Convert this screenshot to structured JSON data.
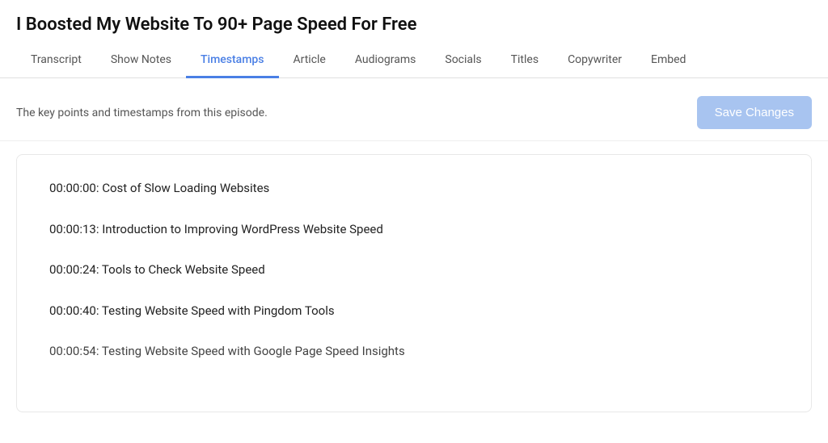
{
  "page": {
    "title": "I Boosted My Website To 90+ Page Speed For Free"
  },
  "tabs": [
    {
      "id": "transcript",
      "label": "Transcript",
      "active": false
    },
    {
      "id": "show-notes",
      "label": "Show Notes",
      "active": false
    },
    {
      "id": "timestamps",
      "label": "Timestamps",
      "active": true
    },
    {
      "id": "article",
      "label": "Article",
      "active": false
    },
    {
      "id": "audiograms",
      "label": "Audiograms",
      "active": false
    },
    {
      "id": "socials",
      "label": "Socials",
      "active": false
    },
    {
      "id": "titles",
      "label": "Titles",
      "active": false
    },
    {
      "id": "copywriter",
      "label": "Copywriter",
      "active": false
    },
    {
      "id": "embed",
      "label": "Embed",
      "active": false
    }
  ],
  "content": {
    "description": "The key points and timestamps from this episode.",
    "save_button_label": "Save Changes"
  },
  "timestamps": [
    {
      "time": "00:00:00",
      "label": "Cost of Slow Loading Websites"
    },
    {
      "time": "00:00:13",
      "label": "Introduction to Improving WordPress Website Speed"
    },
    {
      "time": "00:00:24",
      "label": "Tools to Check Website Speed"
    },
    {
      "time": "00:00:40",
      "label": "Testing Website Speed with Pingdom Tools"
    },
    {
      "time": "00:00:54",
      "label": "Testing Website Speed with Google Page Speed Insights"
    }
  ]
}
